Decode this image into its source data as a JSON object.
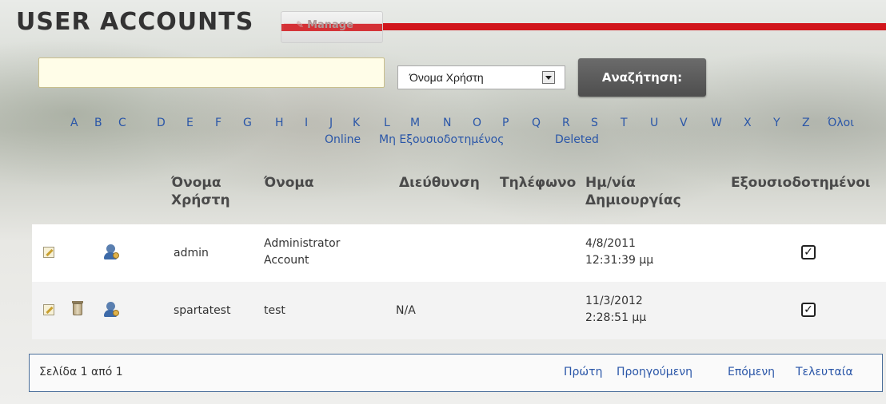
{
  "header": {
    "title": "USER ACCOUNTS",
    "manage_label": "Manage",
    "brand_red": "#d1161c"
  },
  "search": {
    "value": "",
    "select_value": "Όνομα Χρήστη",
    "button_label": "Αναζήτηση:"
  },
  "alphabet": [
    "A",
    "B",
    "C",
    "D",
    "E",
    "F",
    "G",
    "H",
    "I",
    "J",
    "K",
    "L",
    "M",
    "N",
    "O",
    "P",
    "Q",
    "R",
    "S",
    "T",
    "U",
    "V",
    "W",
    "X",
    "Y",
    "Z",
    "Όλοι"
  ],
  "filters": [
    "Online",
    "Μη Εξουσιοδοτημένος",
    "Deleted"
  ],
  "table": {
    "columns": {
      "username": [
        "Όνομα",
        "Χρήστη"
      ],
      "name": "Όνομα",
      "address": "Διεύθυνση",
      "phone": "Τηλέφωνο",
      "created": [
        "Ημ/νία",
        "Δημιουργίας"
      ],
      "authorized": "Εξουσιοδοτημένοι"
    },
    "rows": [
      {
        "username": "admin",
        "name": [
          "Administrator",
          "Account"
        ],
        "address": "",
        "phone": "",
        "created": [
          "4/8/2011",
          "12:31:39 μμ"
        ],
        "authorized": true
      },
      {
        "username": "spartatest",
        "name": [
          "test"
        ],
        "address": "N/A",
        "phone": "",
        "created": [
          "11/3/2012",
          "2:28:51 μμ"
        ],
        "authorized": true
      }
    ]
  },
  "pager": {
    "info": "Σελίδα 1 από 1",
    "first": "Πρώτη",
    "prev": "Προηγούμενη",
    "next": "Επόμενη",
    "last": "Τελευταία"
  }
}
